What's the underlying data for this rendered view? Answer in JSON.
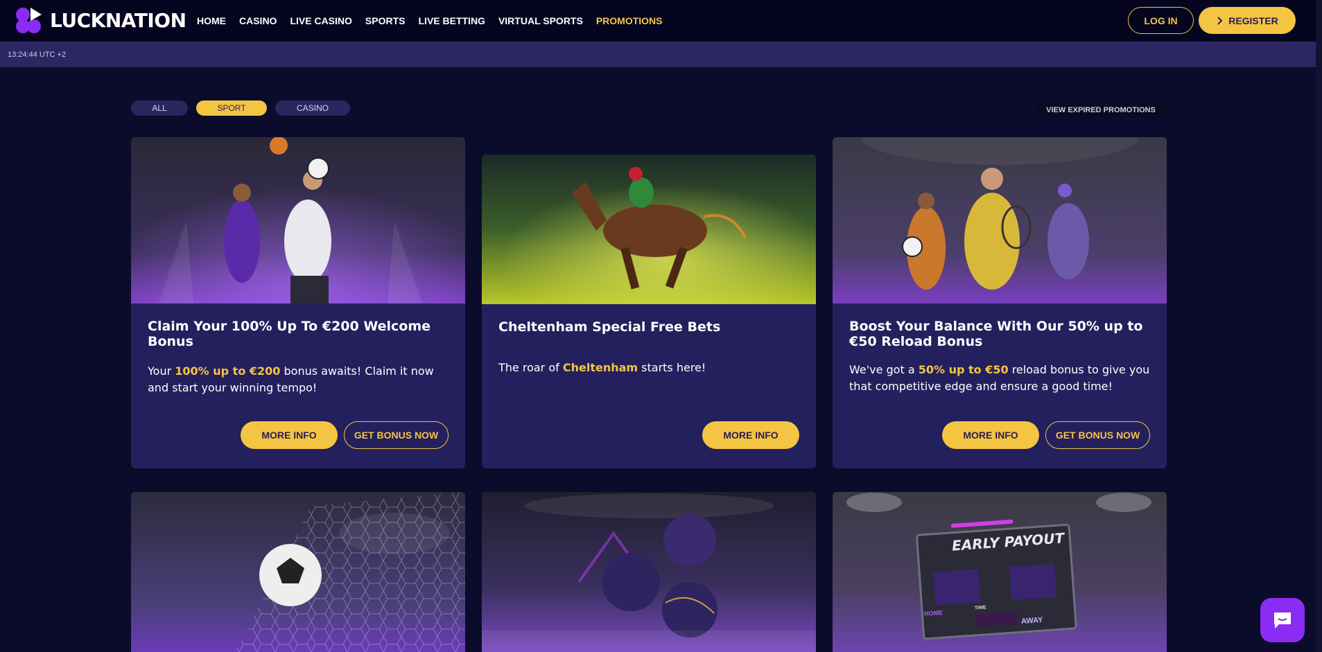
{
  "brand": {
    "name": "LUCKNATION"
  },
  "nav": {
    "items": [
      {
        "label": "HOME"
      },
      {
        "label": "CASINO"
      },
      {
        "label": "LIVE CASINO"
      },
      {
        "label": "SPORTS"
      },
      {
        "label": "LIVE BETTING"
      },
      {
        "label": "VIRTUAL SPORTS"
      },
      {
        "label": "PROMOTIONS"
      }
    ],
    "active": "PROMOTIONS"
  },
  "auth": {
    "login_label": "LOG IN",
    "register_label": "REGISTER"
  },
  "timebar": {
    "time": "13:24:44 UTC +2"
  },
  "filters": {
    "all": "ALL",
    "sport": "SPORT",
    "casino": "CASINO",
    "selected": "SPORT"
  },
  "expired_label": "VIEW EXPIRED PROMOTIONS",
  "cards": [
    {
      "title": "Claim Your 100% Up To €200 Welcome Bonus",
      "text_pre": "Your ",
      "text_hl": "100% up to €200",
      "text_post": " bonus awaits! Claim it now and start your winning tempo!",
      "more_label": "MORE INFO",
      "bonus_label": "GET BONUS NOW"
    },
    {
      "title": "Cheltenham Special Free Bets",
      "text_pre": "The roar of ",
      "text_hl": "Cheltenham",
      "text_post": " starts here!",
      "more_label": "MORE INFO"
    },
    {
      "title": "Boost Your Balance With Our 50% up to €50 Reload Bonus",
      "text_pre": "We've got a ",
      "text_hl": "50% up to €50",
      "text_post": " reload bonus to give you that competitive edge and ensure a good time!",
      "more_label": "MORE INFO",
      "bonus_label": "GET BONUS NOW"
    }
  ],
  "scoreboard": {
    "title": "EARLY PAYOUT",
    "home": "HOME",
    "away": "AWAY",
    "time": "TIME"
  },
  "colors": {
    "accent": "#f4c542",
    "card": "#24205d",
    "background": "#0b0c2b",
    "header": "#050520",
    "chat": "#8b2cf5"
  }
}
